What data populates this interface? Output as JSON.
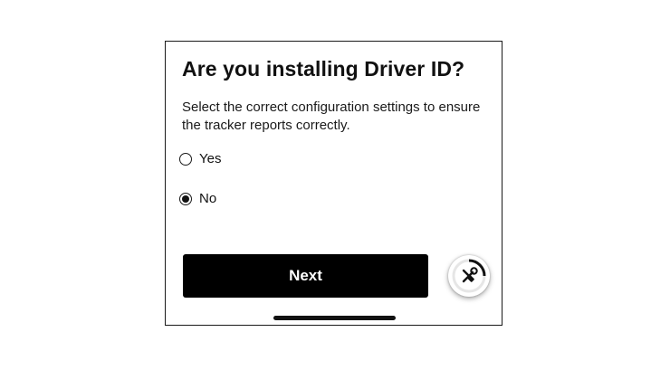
{
  "screen": {
    "title": "Are you installing Driver ID?",
    "subtitle": "Select the correct configuration settings to ensure the tracker reports correctly."
  },
  "options": [
    {
      "label": "Yes",
      "selected": false
    },
    {
      "label": "No",
      "selected": true
    }
  ],
  "actions": {
    "next_label": "Next"
  },
  "fab": {
    "icon": "tools-icon"
  },
  "colors": {
    "primary_button": "#000000",
    "button_text": "#ffffff",
    "text": "#111111"
  }
}
